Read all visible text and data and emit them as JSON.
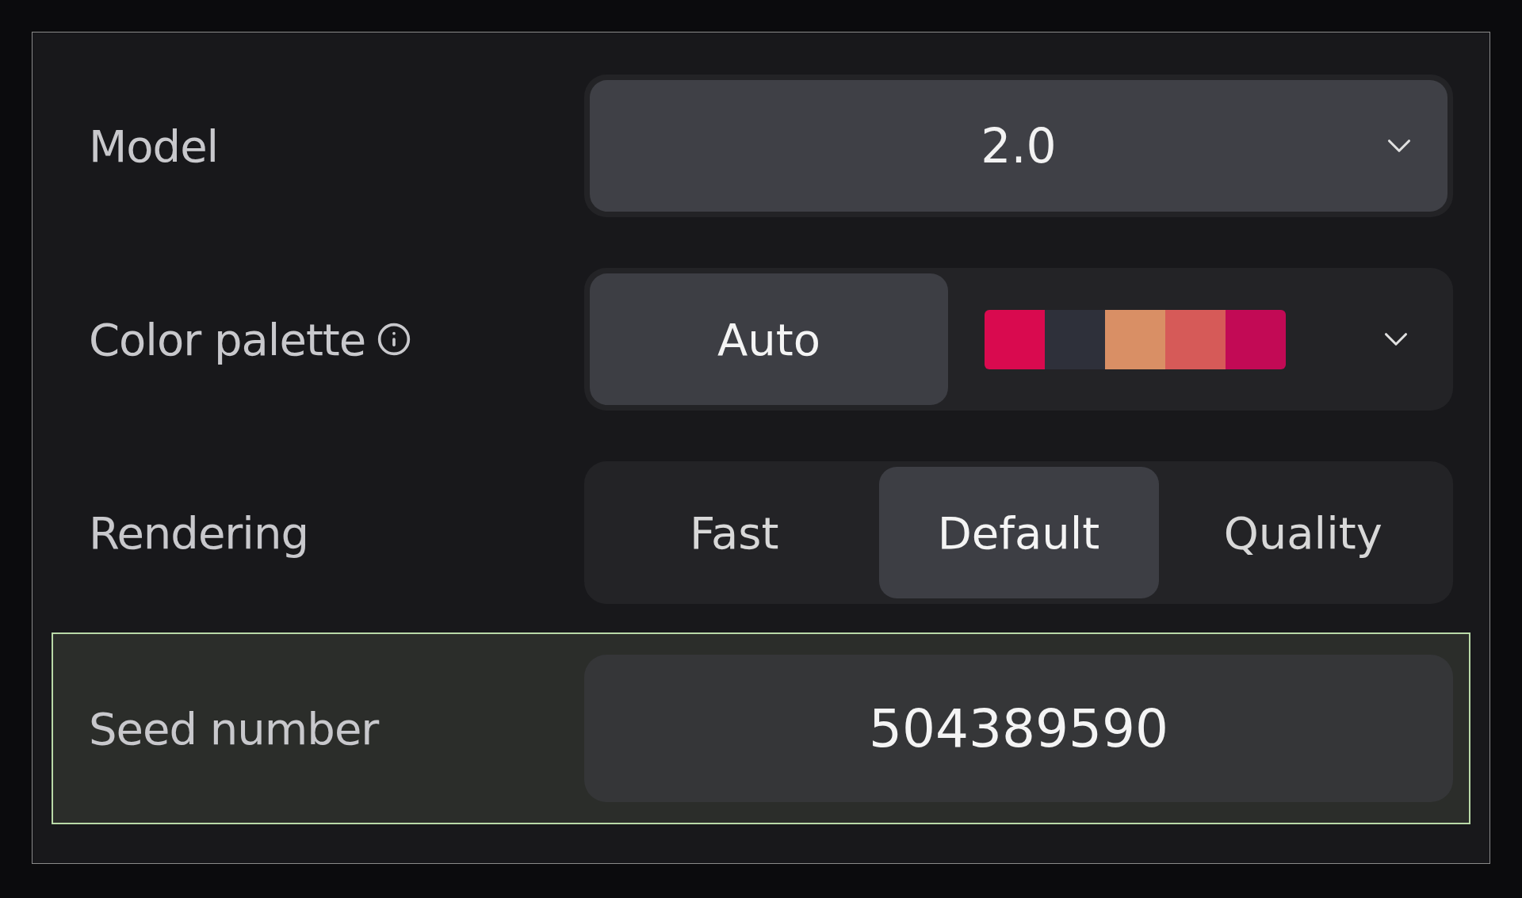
{
  "model": {
    "label": "Model",
    "value": "2.0"
  },
  "color_palette": {
    "label": "Color palette",
    "options": [
      {
        "kind": "auto",
        "label": "Auto",
        "selected": true
      },
      {
        "kind": "swatches",
        "selected": false,
        "swatches": [
          {
            "color": "#d90a4f"
          },
          {
            "color": "#2e303a"
          },
          {
            "color": "#d98f65"
          },
          {
            "color": "#d65a58"
          },
          {
            "color": "#c20a55"
          }
        ]
      }
    ]
  },
  "rendering": {
    "label": "Rendering",
    "options": [
      {
        "label": "Fast",
        "selected": false
      },
      {
        "label": "Default",
        "selected": true
      },
      {
        "label": "Quality",
        "selected": false
      }
    ]
  },
  "seed": {
    "label": "Seed number",
    "value": "504389590",
    "highlighted": true
  }
}
